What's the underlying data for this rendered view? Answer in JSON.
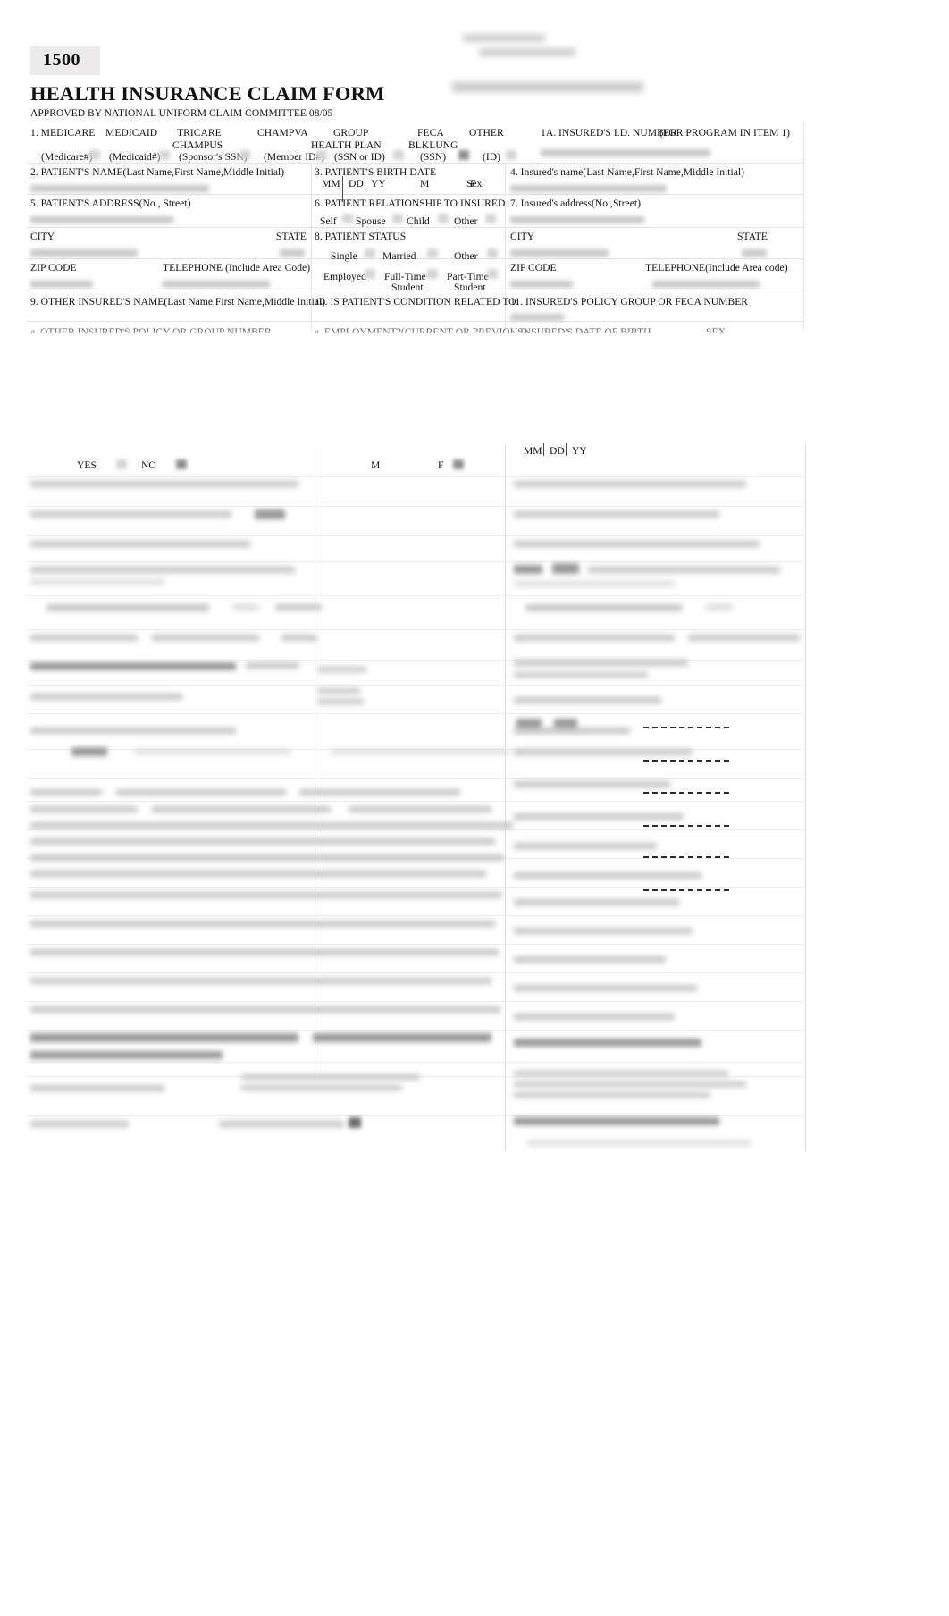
{
  "document": {
    "form_number": "1500",
    "title": "HEALTH INSURANCE CLAIM FORM",
    "subtitle": "APPROVED BY NATIONAL UNIFORM CLAIM COMMITTEE 08/05"
  },
  "carrier_block": {
    "redacted": true,
    "note": "carrier name and address block (illegible / blurred)"
  },
  "item1": {
    "number": "1.",
    "options": [
      {
        "label": "MEDICARE",
        "sub": "(Medicare#)"
      },
      {
        "label": "MEDICAID",
        "sub": "(Medicaid#)"
      },
      {
        "label": "TRICARE\nCHAMPUS",
        "line1": "TRICARE",
        "line2": "CHAMPUS",
        "sub": "(Sponsor's SSN)"
      },
      {
        "label": "CHAMPVA",
        "sub": "(Member ID#)"
      },
      {
        "label": "GROUP\nHEALTH PLAN",
        "line1": "GROUP",
        "line2": "HEALTH PLAN",
        "sub": "(SSN or ID)"
      },
      {
        "label": "FECA\nBLKLUNG",
        "line1": "FECA",
        "line2": "BLKLUNG",
        "sub": "(SSN)"
      },
      {
        "label": "OTHER",
        "sub": "(ID)"
      }
    ]
  },
  "item1a": {
    "label": "1A. INSURED'S I.D. NUMBER",
    "note": "(FOR PROGRAM IN ITEM 1)",
    "value": ""
  },
  "item2": {
    "label": "2. PATIENT'S NAME(Last Name,First Name,Middle Initial)",
    "value": ""
  },
  "item3": {
    "label": "3. PATIENT'S BIRTH DATE",
    "mm": "MM",
    "dd": "DD",
    "yy": "YY",
    "sex_label": "Sex",
    "sex_male": "M",
    "sex_female": "F",
    "value": ""
  },
  "item4": {
    "label": "4. Insured's name(Last Name,First Name,Middle Initial)",
    "value": ""
  },
  "item5": {
    "label": "5. PATIENT'S ADDRESS(No., Street)",
    "city_label": "CITY",
    "state_label": "STATE",
    "zip_label": "ZIP CODE",
    "telephone_label": "TELEPHONE (Include Area Code)",
    "address": "",
    "city": "",
    "state": "",
    "zip": "",
    "telephone": ""
  },
  "item6": {
    "label": "6. PATIENT RELATIONSHIP TO INSURED",
    "options": [
      "Self",
      "Spouse",
      "Child",
      "Other"
    ]
  },
  "item7": {
    "label": "7. Insured's address(No.,Street)",
    "city_label": "CITY",
    "state_label": "STATE",
    "zip_label": "ZIP CODE",
    "telephone_label": "TELEPHONE(Include Area code)",
    "address": "",
    "city": "",
    "state": "",
    "zip": "",
    "telephone": ""
  },
  "item8": {
    "label": "8. PATIENT STATUS",
    "row1": [
      "Single",
      "Married",
      "Other"
    ],
    "row2": [
      {
        "line1": "Employed",
        "line2": ""
      },
      {
        "line1": "Full-Time",
        "line2": "Student"
      },
      {
        "line1": "Part-Time",
        "line2": "Student"
      }
    ]
  },
  "item9": {
    "label": "9. OTHER INSURED'S NAME(Last Name,First Name,Middle Initial)",
    "value": ""
  },
  "item9a": {
    "label": "a. OTHER INSURED'S POLICY OR GROUP NUMBER",
    "value": ""
  },
  "item10": {
    "label": "10. IS PATIENT'S CONDITION RELATED TO:",
    "sub_a": "a. EMPLOYMENT?(CURRENT OR PREVIOUS)",
    "yes": "YES",
    "no": "NO"
  },
  "item11": {
    "label": "11. INSURED'S POLICY GROUP OR FECA NUMBER",
    "value": ""
  },
  "item11a": {
    "label": "a. INSURED'S DATE OF BIRTH",
    "sex_label": "SEX",
    "mm": "MM",
    "dd": "DD",
    "yy": "YY",
    "sex_male": "M",
    "sex_female": "F"
  },
  "lower_section": {
    "redacted": true,
    "note": "remainder of CMS-1500 claim form body — field labels, service line table and signature areas are blurred/illegible in this capture",
    "dashed_markers": 6
  }
}
